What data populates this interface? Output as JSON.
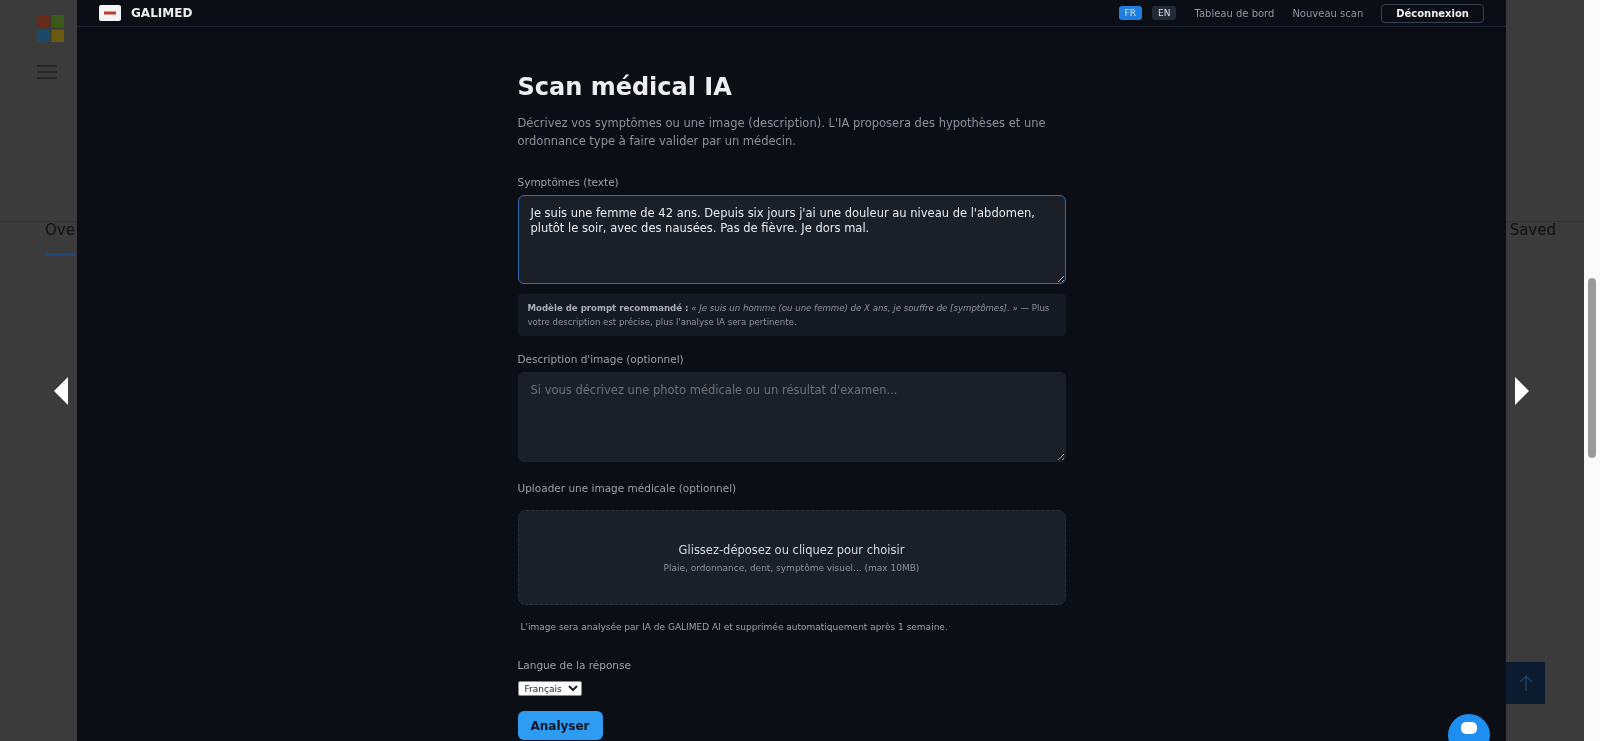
{
  "background_page": {
    "tabs": [
      {
        "label": "Ove",
        "selected": true
      },
      {
        "label": "Saved",
        "selected": false
      }
    ]
  },
  "viewer": {
    "app": {
      "brand": "GALIMED",
      "languages": [
        {
          "label": "FR",
          "selected": true
        },
        {
          "label": "EN",
          "selected": false
        }
      ],
      "nav": [
        "Tableau de bord",
        "Nouveau scan"
      ],
      "logout": "Déconnexion",
      "title": "Scan médical IA",
      "intro": "Décrivez vos symptômes ou une image (description). L'IA proposera des hypothèses et une ordonnance type à faire valider par un médecin.",
      "symptoms": {
        "label": "Symptômes (texte)",
        "value": "Je suis une femme de 42 ans. Depuis six jours j'ai une douleur au niveau de l'abdomen, plutôt le soir, avec des nausées. Pas de fièvre. Je dors mal."
      },
      "hint": "**Modèle de prompt recommandé :** *« Je suis un homme (ou une femme) de X ans, je souffre de [symptômes]. »* — Plus votre description est précise, plus l'analyse IA sera pertinente.",
      "image_description": {
        "label": "Description d'image (optionnel)",
        "placeholder": "Si vous décrivez une photo médicale ou un résultat d'examen..."
      },
      "upload": {
        "label": "Uploader une image médicale (optionnel)",
        "title": "Glissez-déposez ou cliquez pour choisir",
        "subtitle": "Plaie, ordonnance, dent, symptôme visuel... (max 10MB)"
      },
      "upload_note": "L'image sera analysée par IA de GALIMED AI et supprimée automatiquement après 1 semaine.",
      "language": {
        "label": "Langue de la réponse",
        "value": "Français"
      },
      "submit": "Analyser"
    }
  }
}
